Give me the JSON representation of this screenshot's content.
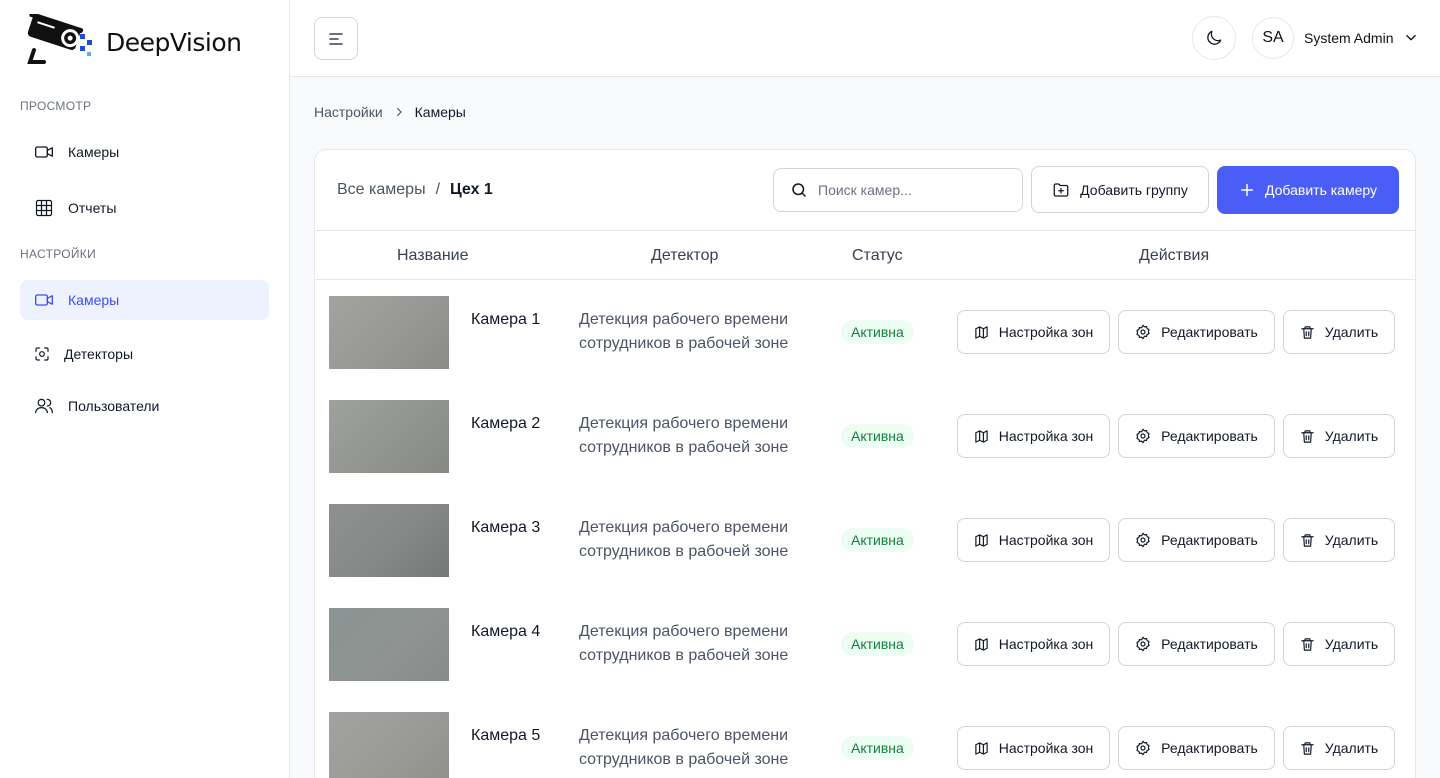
{
  "brand": {
    "name": "DeepVision",
    "accent": "#4a5ef7"
  },
  "sidebar": {
    "sections": [
      {
        "label": "ПРОСМОТР"
      },
      {
        "label": "НАСТРОЙКИ"
      }
    ],
    "view_items": [
      {
        "label": "Камеры",
        "icon": "video-icon"
      },
      {
        "label": "Отчеты",
        "icon": "table-icon"
      }
    ],
    "settings_items": [
      {
        "label": "Камеры",
        "icon": "video-icon",
        "active": true
      },
      {
        "label": "Детекторы",
        "icon": "scan-icon"
      },
      {
        "label": "Пользователи",
        "icon": "users-icon"
      }
    ]
  },
  "header": {
    "avatar_initials": "SA",
    "user_name": "System Admin"
  },
  "breadcrumb": {
    "parent": "Настройки",
    "current": "Камеры"
  },
  "card": {
    "title_root": "Все камеры",
    "title_sep": "/",
    "title_group": "Цех 1",
    "search_placeholder": "Поиск камер...",
    "add_group_label": "Добавить группу",
    "add_camera_label": "Добавить камеру"
  },
  "table": {
    "columns": [
      "Название",
      "Детектор",
      "Статус",
      "Действия"
    ],
    "actions": {
      "zones": "Настройка зон",
      "edit": "Редактировать",
      "delete": "Удалить"
    },
    "rows": [
      {
        "name": "Камера 1",
        "detector": "Детекция рабочего времени сотрудников в рабочей зоне",
        "status": "Активна"
      },
      {
        "name": "Камера 2",
        "detector": "Детекция рабочего времени сотрудников в рабочей зоне",
        "status": "Активна"
      },
      {
        "name": "Камера 3",
        "detector": "Детекция рабочего времени сотрудников в рабочей зоне",
        "status": "Активна"
      },
      {
        "name": "Камера 4",
        "detector": "Детекция рабочего времени сотрудников в рабочей зоне",
        "status": "Активна"
      },
      {
        "name": "Камера 5",
        "detector": "Детекция рабочего времени сотрудников в рабочей зоне",
        "status": "Активна"
      }
    ]
  }
}
